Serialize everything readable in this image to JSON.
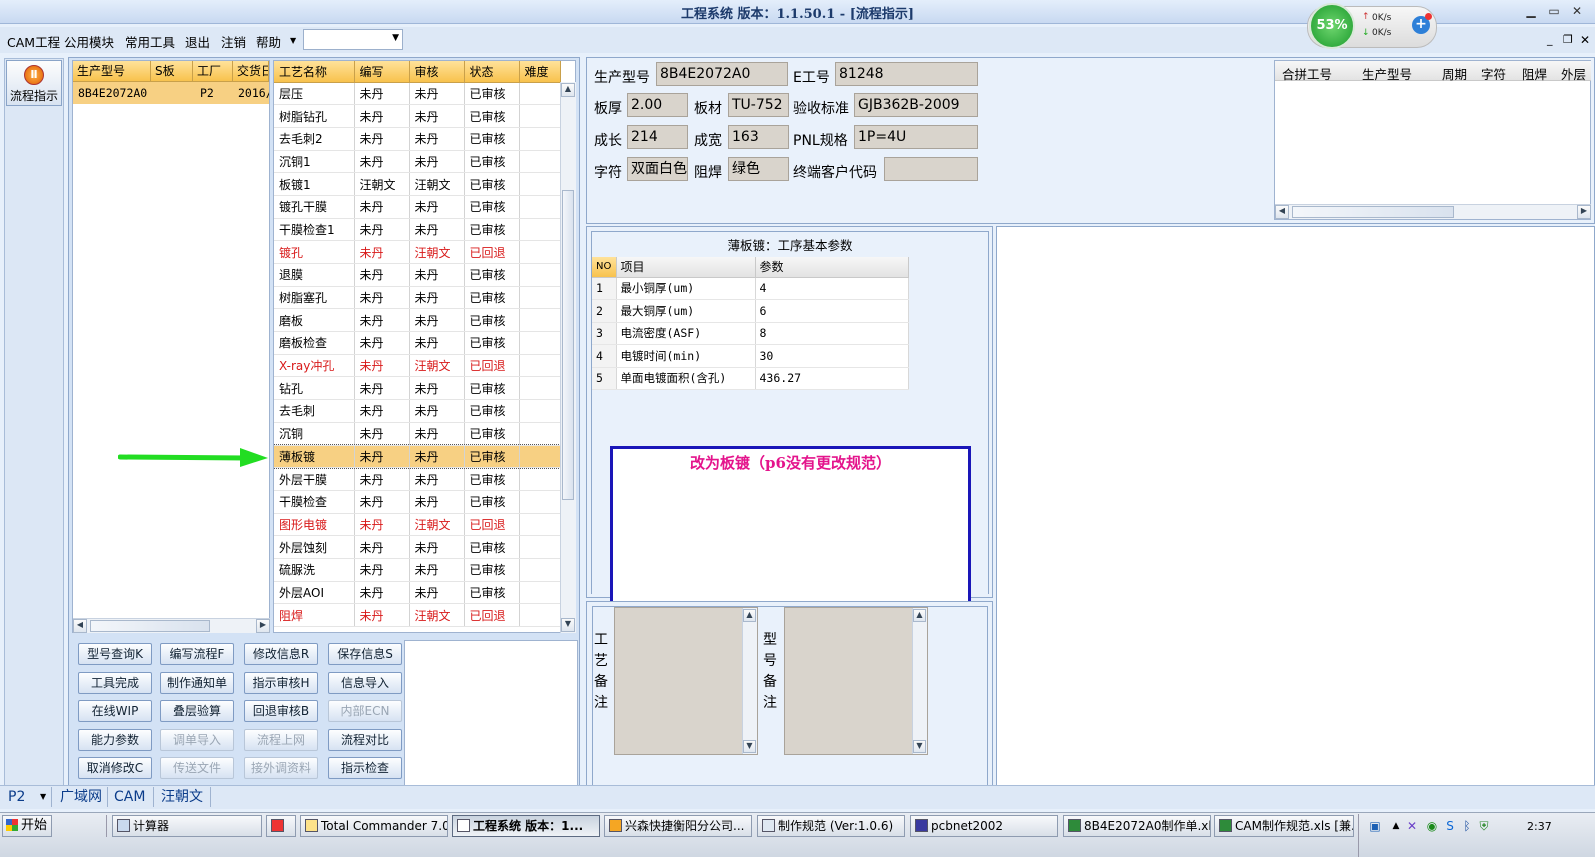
{
  "window": {
    "title": "工程系统   版本：1.1.50.1 - [流程指示]"
  },
  "menu": {
    "items": [
      "CAM工程",
      "公用模块",
      "常用工具",
      "退出",
      "注销",
      "帮助"
    ],
    "combo_value": ""
  },
  "net_meter": {
    "percent": "53%",
    "up": "0K/s",
    "down": "0K/s"
  },
  "launcher": {
    "button_label": "流程指示"
  },
  "job_list": {
    "columns": [
      "生产型号",
      "S板",
      "工厂",
      "交货日"
    ],
    "rows": [
      {
        "model": "8B4E2072A0",
        "s": "",
        "factory": "P2",
        "date": "2016/"
      }
    ]
  },
  "process_table": {
    "columns": [
      "工艺名称",
      "编写",
      "审核",
      "状态",
      "难度"
    ],
    "rows": [
      {
        "name": "层压",
        "writer": "未丹",
        "reviewer": "未丹",
        "status": "已审核",
        "red": false
      },
      {
        "name": "树脂钻孔",
        "writer": "未丹",
        "reviewer": "未丹",
        "status": "已审核",
        "red": false
      },
      {
        "name": "去毛刺2",
        "writer": "未丹",
        "reviewer": "未丹",
        "status": "已审核",
        "red": false
      },
      {
        "name": "沉铜1",
        "writer": "未丹",
        "reviewer": "未丹",
        "status": "已审核",
        "red": false
      },
      {
        "name": "板镀1",
        "writer": "汪朝文",
        "reviewer": "汪朝文",
        "status": "已审核",
        "red": false
      },
      {
        "name": "镀孔干膜",
        "writer": "未丹",
        "reviewer": "未丹",
        "status": "已审核",
        "red": false
      },
      {
        "name": "干膜检查1",
        "writer": "未丹",
        "reviewer": "未丹",
        "status": "已审核",
        "red": false
      },
      {
        "name": "镀孔",
        "writer": "未丹",
        "reviewer": "汪朝文",
        "status": "已回退",
        "red": true
      },
      {
        "name": "退膜",
        "writer": "未丹",
        "reviewer": "未丹",
        "status": "已审核",
        "red": false
      },
      {
        "name": "树脂塞孔",
        "writer": "未丹",
        "reviewer": "未丹",
        "status": "已审核",
        "red": false
      },
      {
        "name": "磨板",
        "writer": "未丹",
        "reviewer": "未丹",
        "status": "已审核",
        "red": false
      },
      {
        "name": "磨板检查",
        "writer": "未丹",
        "reviewer": "未丹",
        "status": "已审核",
        "red": false
      },
      {
        "name": "X-ray冲孔",
        "writer": "未丹",
        "reviewer": "汪朝文",
        "status": "已回退",
        "red": true
      },
      {
        "name": "钻孔",
        "writer": "未丹",
        "reviewer": "未丹",
        "status": "已审核",
        "red": false
      },
      {
        "name": "去毛刺",
        "writer": "未丹",
        "reviewer": "未丹",
        "status": "已审核",
        "red": false
      },
      {
        "name": "沉铜",
        "writer": "未丹",
        "reviewer": "未丹",
        "status": "已审核",
        "red": false
      },
      {
        "name": "薄板镀",
        "writer": "未丹",
        "reviewer": "未丹",
        "status": "已审核",
        "red": false,
        "selected": true
      },
      {
        "name": "外层干膜",
        "writer": "未丹",
        "reviewer": "未丹",
        "status": "已审核",
        "red": false
      },
      {
        "name": "干膜检查",
        "writer": "未丹",
        "reviewer": "未丹",
        "status": "已审核",
        "red": false
      },
      {
        "name": "图形电镀",
        "writer": "未丹",
        "reviewer": "汪朝文",
        "status": "已回退",
        "red": true
      },
      {
        "name": "外层蚀刻",
        "writer": "未丹",
        "reviewer": "未丹",
        "status": "已审核",
        "red": false
      },
      {
        "name": "硫脲洗",
        "writer": "未丹",
        "reviewer": "未丹",
        "status": "已审核",
        "red": false
      },
      {
        "name": "外层AOI",
        "writer": "未丹",
        "reviewer": "未丹",
        "status": "已审核",
        "red": false
      },
      {
        "name": "阻焊",
        "writer": "未丹",
        "reviewer": "汪朝文",
        "status": "已回退",
        "red": true
      }
    ]
  },
  "buttons": [
    {
      "label": "型号查询K",
      "disabled": false
    },
    {
      "label": "编写流程F",
      "disabled": false
    },
    {
      "label": "修改信息R",
      "disabled": false
    },
    {
      "label": "保存信息S",
      "disabled": false
    },
    {
      "label": "工具完成",
      "disabled": false
    },
    {
      "label": "制作通知单",
      "disabled": false
    },
    {
      "label": "指示审核H",
      "disabled": false
    },
    {
      "label": "信息导入",
      "disabled": false
    },
    {
      "label": "在线WIP",
      "disabled": false
    },
    {
      "label": "叠层验算",
      "disabled": false
    },
    {
      "label": "回退审核B",
      "disabled": false
    },
    {
      "label": "内部ECN",
      "disabled": true
    },
    {
      "label": "能力参数",
      "disabled": false
    },
    {
      "label": "调单导入",
      "disabled": true
    },
    {
      "label": "流程上网",
      "disabled": true
    },
    {
      "label": "流程对比",
      "disabled": false
    },
    {
      "label": "取消修改C",
      "disabled": false
    },
    {
      "label": "传送文件",
      "disabled": true
    },
    {
      "label": "接外调资料",
      "disabled": true
    },
    {
      "label": "指示检查",
      "disabled": false
    }
  ],
  "info": {
    "model_label": "生产型号",
    "model_value": "8B4E2072A0",
    "e_label": "E工号",
    "e_value": "81248",
    "thickness_label": "板厚",
    "thickness_value": "2.00",
    "material_label": "板材",
    "material_value": "TU-752",
    "standard_label": "验收标准",
    "standard_value": "GJB362B-2009",
    "length_label": "成长",
    "length_value": "214",
    "width_label": "成宽",
    "width_value": "163",
    "pnl_label": "PNL规格",
    "pnl_value": "1P=4U",
    "char_label": "字符",
    "char_value": "双面白色",
    "mask_label": "阻焊",
    "mask_value": "绿色",
    "customer_label": "终端客户代码",
    "customer_value": ""
  },
  "merge_table": {
    "columns": [
      "合拼工号",
      "生产型号",
      "周期",
      "字符",
      "阻焊",
      "外层"
    ]
  },
  "params": {
    "title": "薄板镀：工序基本参数",
    "columns": [
      "NO",
      "项目",
      "参数"
    ],
    "rows": [
      {
        "no": "1",
        "item": "最小铜厚(um)",
        "value": "4"
      },
      {
        "no": "2",
        "item": "最大铜厚(um)",
        "value": "6"
      },
      {
        "no": "3",
        "item": "电流密度(ASF)",
        "value": "8"
      },
      {
        "no": "4",
        "item": "电镀时间(min)",
        "value": "30"
      },
      {
        "no": "5",
        "item": "单面电镀面积(含孔)",
        "value": "436.27"
      }
    ]
  },
  "annotation": {
    "text": "改为板镀（p6没有更改规范）",
    "color": "#e4148c",
    "arrow_color": "#22dd22"
  },
  "remarks": {
    "process_label": "工艺备注",
    "model_label": "型号备注"
  },
  "status_bar": {
    "factory": "P2",
    "network": "广域网",
    "module": "CAM",
    "user": "汪朝文"
  },
  "taskbar": {
    "start": "开始",
    "tasks": [
      "计算器",
      "",
      "Total Commander 7.0 ...",
      "工程系统  版本：1...",
      "兴森快捷衡阳分公司...",
      "制作规范 (Ver:1.0.6)",
      "pcbnet2002",
      "8B4E2072A0制作单.xl...",
      "CAM制作规范.xls [兼..."
    ],
    "clock": "2:37"
  }
}
